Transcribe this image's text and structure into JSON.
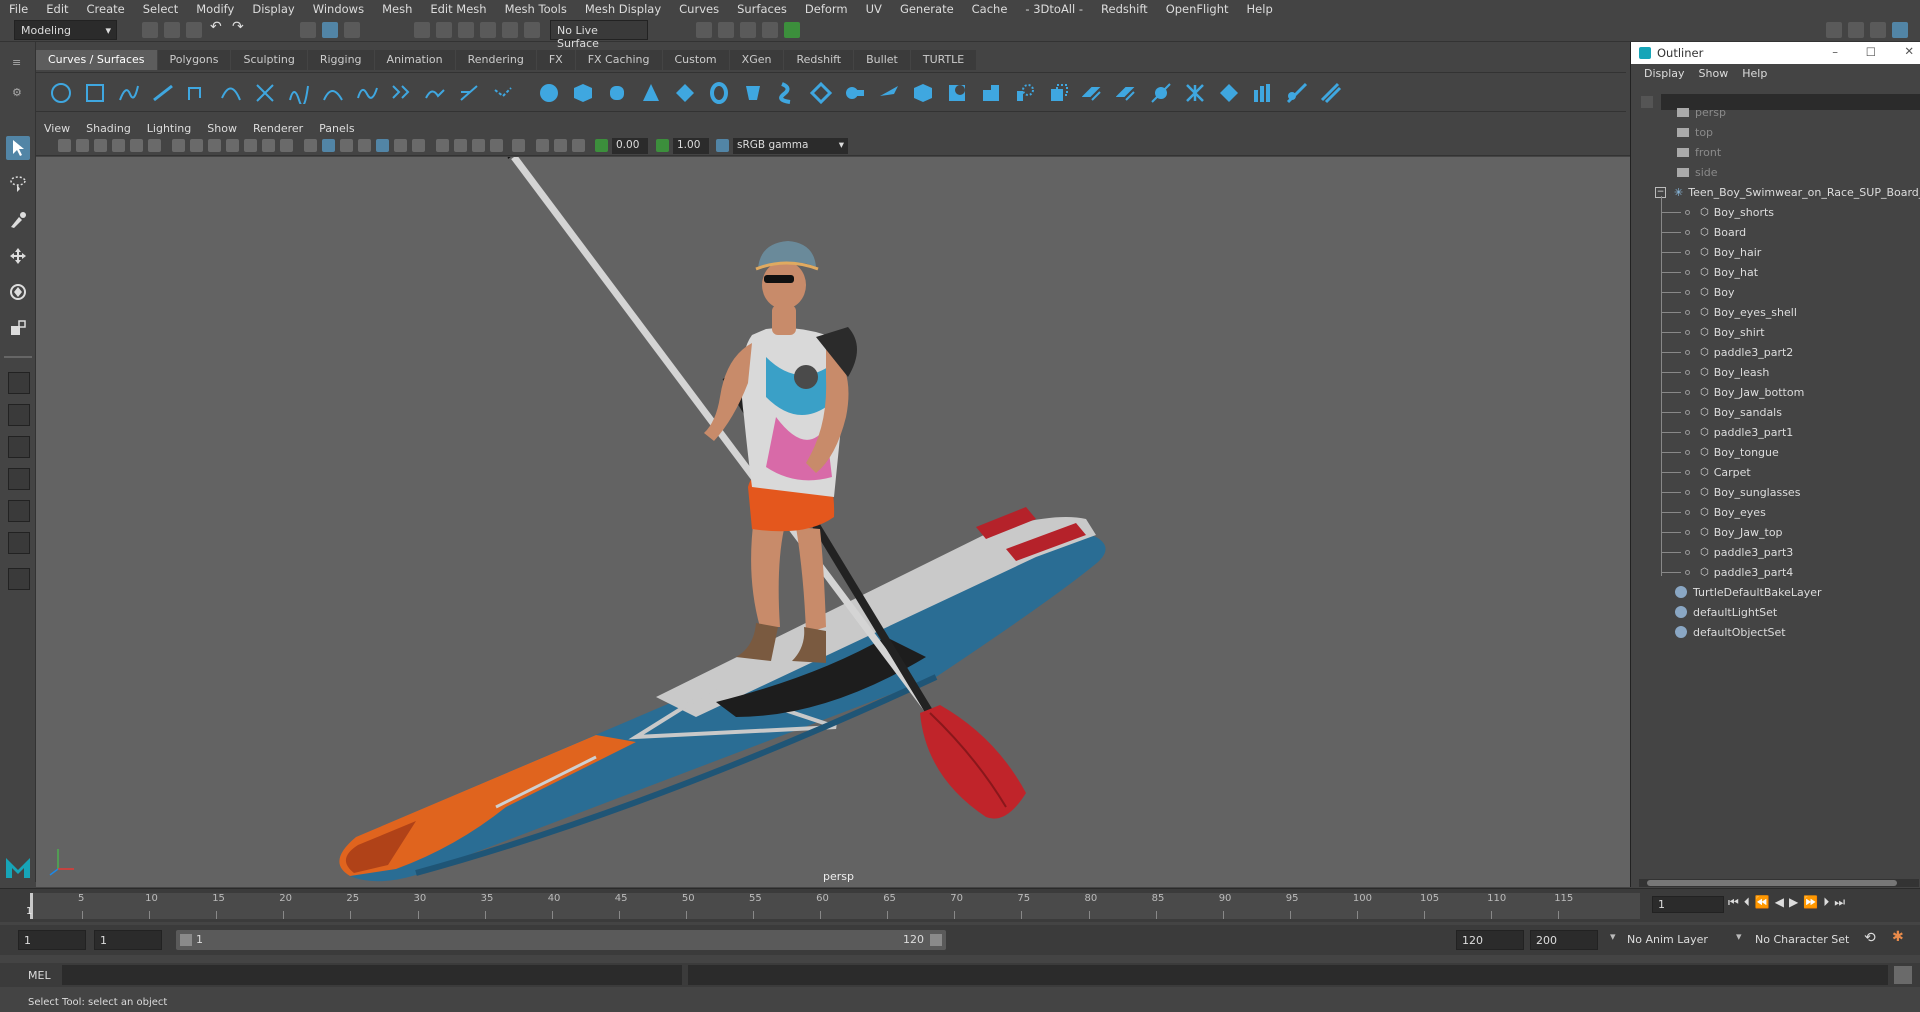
{
  "menubar": [
    "File",
    "Edit",
    "Create",
    "Select",
    "Modify",
    "Display",
    "Windows",
    "Mesh",
    "Edit Mesh",
    "Mesh Tools",
    "Mesh Display",
    "Curves",
    "Surfaces",
    "Deform",
    "UV",
    "Generate",
    "Cache",
    "- 3DtoAll -",
    "Redshift",
    "OpenFlight",
    "Help"
  ],
  "status": {
    "workspace": "Modeling",
    "live_surface": "No Live Surface"
  },
  "shelf_tabs": [
    "Curves / Surfaces",
    "Polygons",
    "Sculpting",
    "Rigging",
    "Animation",
    "Rendering",
    "FX",
    "FX Caching",
    "Custom",
    "XGen",
    "Redshift",
    "Bullet",
    "TURTLE"
  ],
  "panel_menu": [
    "View",
    "Shading",
    "Lighting",
    "Show",
    "Renderer",
    "Panels"
  ],
  "panel_bar": {
    "exposure": "0.00",
    "gamma": "1.00",
    "color_space": "sRGB gamma"
  },
  "viewport": {
    "camera": "persp"
  },
  "outliner": {
    "title": "Outliner",
    "menu": [
      "Display",
      "Show",
      "Help"
    ],
    "cameras": [
      "persp",
      "top",
      "front",
      "side"
    ],
    "group": "Teen_Boy_Swimwear_on_Race_SUP_Board_n",
    "children": [
      "Boy_shorts",
      "Board",
      "Boy_hair",
      "Boy_hat",
      "Boy",
      "Boy_eyes_shell",
      "Boy_shirt",
      "paddle3_part2",
      "Boy_leash",
      "Boy_Jaw_bottom",
      "Boy_sandals",
      "paddle3_part1",
      "Boy_tongue",
      "Carpet",
      "Boy_sunglasses",
      "Boy_eyes",
      "Boy_Jaw_top",
      "paddle3_part3",
      "paddle3_part4"
    ],
    "sets": [
      "TurtleDefaultBakeLayer",
      "defaultLightSet",
      "defaultObjectSet"
    ]
  },
  "timeline": {
    "ticks": [
      "5",
      "10",
      "15",
      "20",
      "25",
      "30",
      "35",
      "40",
      "45",
      "50",
      "55",
      "60",
      "65",
      "70",
      "75",
      "80",
      "85",
      "90",
      "95",
      "100",
      "105",
      "110",
      "115"
    ],
    "current_marker": "1",
    "current_frame": "1"
  },
  "range": {
    "start": "1",
    "inner_start": "1",
    "slider_start": "1",
    "slider_end": "120",
    "end": "120",
    "max_end": "200",
    "anim_layer": "No Anim Layer",
    "char_set": "No Character Set"
  },
  "cmd": {
    "label": "MEL"
  },
  "help": "Select Tool: select an object",
  "colors": {
    "accent": "#5285a6",
    "viewport_bg": "#636363",
    "board_blue": "#2a6d94",
    "board_orange": "#e0641e",
    "paddle_red": "#c0242a"
  }
}
